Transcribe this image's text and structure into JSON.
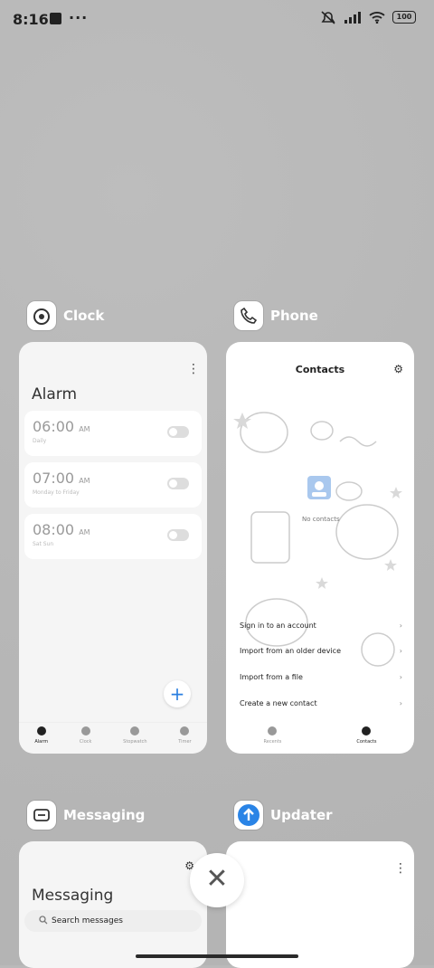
{
  "status_bar": {
    "time": "8:16",
    "battery": "100"
  },
  "apps": {
    "clock": {
      "label": "Clock",
      "title": "Alarm",
      "alarms": [
        {
          "time": "06:00",
          "ampm": "AM",
          "repeat": "Daily"
        },
        {
          "time": "07:00",
          "ampm": "AM",
          "repeat": "Monday to Friday"
        },
        {
          "time": "08:00",
          "ampm": "AM",
          "repeat": "Sat Sun"
        }
      ],
      "tabs": [
        "Alarm",
        "Clock",
        "Stopwatch",
        "Timer"
      ]
    },
    "phone": {
      "label": "Phone",
      "title": "Contacts",
      "no_contacts": "No contacts",
      "options": [
        "Sign in to an account",
        "Import from an older device",
        "Import from a file",
        "Create a new contact"
      ],
      "tabs": [
        "Recents",
        "Contacts"
      ]
    },
    "messaging": {
      "label": "Messaging",
      "title": "Messaging",
      "search_placeholder": "Search messages"
    },
    "updater": {
      "label": "Updater"
    }
  },
  "close_symbol": "✕"
}
